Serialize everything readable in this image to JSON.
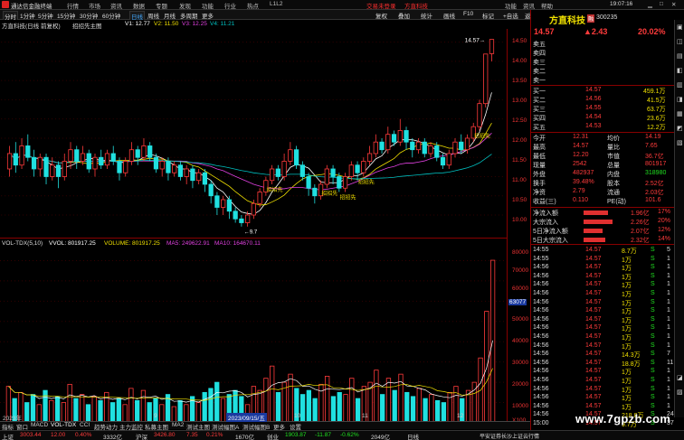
{
  "titlebar": {
    "app_name": "通达信金融终端",
    "menus": [
      "行情",
      "市场",
      "资讯",
      "数据",
      "专题",
      "发现",
      "功能",
      "行业",
      "热点",
      "L1L2"
    ],
    "promo": "交易未登录",
    "stock_tag": "方直科技",
    "right_items": [
      "功能",
      "资讯",
      "帮助"
    ],
    "time": "19:07:16"
  },
  "toolbar": {
    "periods": [
      "分时",
      "1分钟",
      "5分钟",
      "15分钟",
      "30分钟",
      "60分钟",
      "日线",
      "周线",
      "月线",
      "多周期",
      "更多"
    ],
    "right_tools": [
      "复权",
      "叠加",
      "统计",
      "画线",
      "F10",
      "标记",
      "+自选",
      "返回"
    ]
  },
  "chart": {
    "header_name": "方直科技(日线 前复权)",
    "indicator": "招招先主图",
    "ma_v1": "V1: 12.77",
    "ma_v2": "V2: 11.50",
    "ma_v3": "V3: 12.25",
    "ma_v4": "V4: 11.21",
    "peak_label": "14.57",
    "low_label": "9.7",
    "signal_label": "招招先",
    "price_ticks": [
      "14.50",
      "14.00",
      "13.50",
      "13.00",
      "12.50",
      "12.00",
      "11.50",
      "11.00",
      "10.50",
      "10.00"
    ],
    "volume_header": {
      "name": "VOL-TDX(5,10)",
      "vvol": "VVOL: 801917.25",
      "volume": "VOLUME: 801917.25",
      "ma5": "MA5: 249622.91",
      "ma10": "MA10: 164670.11"
    },
    "volume_ticks": [
      "80000",
      "70000",
      "60000",
      "50000",
      "40000",
      "30000",
      "20000",
      "10000"
    ],
    "volume_unit": "X100",
    "volume_marker": "63077",
    "time_labels": [
      "2023年",
      "9",
      "10",
      "11",
      "12",
      "2023/09/15/五"
    ],
    "candles": [
      {
        "o": 11.2,
        "c": 11.6,
        "h": 11.8,
        "l": 11.0
      },
      {
        "o": 11.6,
        "c": 11.3,
        "h": 11.9,
        "l": 11.1
      },
      {
        "o": 11.3,
        "c": 11.8,
        "h": 12.0,
        "l": 11.2
      },
      {
        "o": 11.8,
        "c": 11.5,
        "h": 12.1,
        "l": 11.4
      },
      {
        "o": 11.5,
        "c": 11.2,
        "h": 11.7,
        "l": 11.0
      },
      {
        "o": 11.2,
        "c": 11.5,
        "h": 11.6,
        "l": 11.0
      },
      {
        "o": 11.5,
        "c": 11.0,
        "h": 11.6,
        "l": 10.8
      },
      {
        "o": 11.0,
        "c": 11.3,
        "h": 11.5,
        "l": 10.9
      },
      {
        "o": 11.3,
        "c": 11.0,
        "h": 11.4,
        "l": 10.7
      },
      {
        "o": 11.0,
        "c": 11.4,
        "h": 11.6,
        "l": 10.9
      },
      {
        "o": 11.4,
        "c": 11.7,
        "h": 11.9,
        "l": 11.2
      },
      {
        "o": 11.7,
        "c": 11.4,
        "h": 11.8,
        "l": 11.2
      },
      {
        "o": 11.4,
        "c": 11.6,
        "h": 11.8,
        "l": 11.3
      },
      {
        "o": 11.6,
        "c": 11.2,
        "h": 11.7,
        "l": 11.1
      },
      {
        "o": 11.2,
        "c": 11.5,
        "h": 11.6,
        "l": 11.0
      },
      {
        "o": 11.5,
        "c": 11.3,
        "h": 11.7,
        "l": 11.2
      },
      {
        "o": 11.3,
        "c": 11.6,
        "h": 11.7,
        "l": 11.2
      },
      {
        "o": 11.6,
        "c": 11.4,
        "h": 11.8,
        "l": 11.3
      },
      {
        "o": 11.4,
        "c": 11.1,
        "h": 11.5,
        "l": 10.9
      },
      {
        "o": 11.1,
        "c": 11.4,
        "h": 11.5,
        "l": 11.0
      },
      {
        "o": 11.4,
        "c": 11.7,
        "h": 11.9,
        "l": 11.3
      },
      {
        "o": 11.7,
        "c": 11.5,
        "h": 11.8,
        "l": 11.3
      },
      {
        "o": 11.5,
        "c": 11.8,
        "h": 12.0,
        "l": 11.4
      },
      {
        "o": 11.8,
        "c": 11.5,
        "h": 11.9,
        "l": 11.4
      },
      {
        "o": 11.5,
        "c": 11.2,
        "h": 11.6,
        "l": 11.1
      },
      {
        "o": 11.2,
        "c": 11.4,
        "h": 11.5,
        "l": 11.0
      },
      {
        "o": 11.4,
        "c": 11.1,
        "h": 11.5,
        "l": 10.9
      },
      {
        "o": 11.1,
        "c": 11.3,
        "h": 11.4,
        "l": 11.0
      },
      {
        "o": 11.3,
        "c": 11.0,
        "h": 11.4,
        "l": 10.9
      },
      {
        "o": 11.0,
        "c": 11.2,
        "h": 11.3,
        "l": 10.8
      },
      {
        "o": 11.2,
        "c": 10.9,
        "h": 11.3,
        "l": 10.7
      },
      {
        "o": 10.9,
        "c": 11.1,
        "h": 11.2,
        "l": 10.8
      },
      {
        "o": 11.1,
        "c": 10.8,
        "h": 11.2,
        "l": 10.6
      },
      {
        "o": 10.8,
        "c": 10.5,
        "h": 10.9,
        "l": 10.3
      },
      {
        "o": 10.5,
        "c": 10.2,
        "h": 10.6,
        "l": 10.0
      },
      {
        "o": 10.2,
        "c": 10.4,
        "h": 10.5,
        "l": 10.0
      },
      {
        "o": 10.4,
        "c": 10.1,
        "h": 10.5,
        "l": 9.9
      },
      {
        "o": 10.1,
        "c": 9.9,
        "h": 10.2,
        "l": 9.8
      },
      {
        "o": 9.9,
        "c": 9.8,
        "h": 10.0,
        "l": 9.7
      },
      {
        "o": 9.8,
        "c": 10.0,
        "h": 10.1,
        "l": 9.7
      },
      {
        "o": 10.0,
        "c": 10.3,
        "h": 10.4,
        "l": 9.9
      },
      {
        "o": 10.3,
        "c": 10.6,
        "h": 10.7,
        "l": 10.2
      },
      {
        "o": 10.6,
        "c": 10.9,
        "h": 11.0,
        "l": 10.5
      },
      {
        "o": 10.9,
        "c": 11.2,
        "h": 11.3,
        "l": 10.8
      },
      {
        "o": 11.2,
        "c": 11.0,
        "h": 11.3,
        "l": 10.9
      },
      {
        "o": 11.0,
        "c": 11.4,
        "h": 11.6,
        "l": 10.9
      },
      {
        "o": 11.4,
        "c": 11.7,
        "h": 11.9,
        "l": 11.3
      },
      {
        "o": 11.7,
        "c": 11.3,
        "h": 11.8,
        "l": 11.2
      },
      {
        "o": 11.3,
        "c": 11.0,
        "h": 11.4,
        "l": 10.9
      },
      {
        "o": 11.0,
        "c": 10.7,
        "h": 11.1,
        "l": 10.5
      },
      {
        "o": 10.7,
        "c": 10.5,
        "h": 10.8,
        "l": 10.3
      },
      {
        "o": 10.5,
        "c": 10.8,
        "h": 10.9,
        "l": 10.4
      },
      {
        "o": 10.8,
        "c": 11.2,
        "h": 11.3,
        "l": 10.7
      },
      {
        "o": 11.2,
        "c": 11.0,
        "h": 11.3,
        "l": 10.8
      },
      {
        "o": 11.0,
        "c": 10.7,
        "h": 11.1,
        "l": 10.6
      },
      {
        "o": 10.7,
        "c": 11.0,
        "h": 11.1,
        "l": 10.6
      },
      {
        "o": 11.0,
        "c": 11.3,
        "h": 11.4,
        "l": 10.9
      },
      {
        "o": 11.3,
        "c": 11.1,
        "h": 11.4,
        "l": 10.9
      },
      {
        "o": 11.1,
        "c": 11.4,
        "h": 11.5,
        "l": 11.0
      },
      {
        "o": 11.4,
        "c": 11.6,
        "h": 11.8,
        "l": 11.3
      },
      {
        "o": 11.6,
        "c": 11.9,
        "h": 12.1,
        "l": 11.5
      },
      {
        "o": 11.9,
        "c": 11.7,
        "h": 12.0,
        "l": 11.6
      },
      {
        "o": 11.7,
        "c": 12.1,
        "h": 12.3,
        "l": 11.6
      },
      {
        "o": 12.1,
        "c": 11.9,
        "h": 12.2,
        "l": 11.8
      },
      {
        "o": 11.9,
        "c": 12.2,
        "h": 12.5,
        "l": 11.8
      },
      {
        "o": 12.2,
        "c": 11.9,
        "h": 12.3,
        "l": 11.7
      },
      {
        "o": 11.9,
        "c": 11.7,
        "h": 12.0,
        "l": 11.5
      },
      {
        "o": 11.7,
        "c": 11.9,
        "h": 12.0,
        "l": 11.6
      },
      {
        "o": 11.9,
        "c": 11.6,
        "h": 12.0,
        "l": 11.5
      },
      {
        "o": 11.6,
        "c": 11.8,
        "h": 11.9,
        "l": 11.5
      },
      {
        "o": 11.8,
        "c": 11.5,
        "h": 11.9,
        "l": 11.4
      },
      {
        "o": 11.5,
        "c": 11.3,
        "h": 11.6,
        "l": 11.2
      },
      {
        "o": 11.3,
        "c": 11.6,
        "h": 11.7,
        "l": 11.2
      },
      {
        "o": 11.6,
        "c": 11.9,
        "h": 12.0,
        "l": 11.5
      },
      {
        "o": 11.9,
        "c": 11.7,
        "h": 12.1,
        "l": 11.6
      },
      {
        "o": 11.7,
        "c": 12.0,
        "h": 12.1,
        "l": 11.6
      },
      {
        "o": 12.0,
        "c": 12.3,
        "h": 12.4,
        "l": 11.9
      },
      {
        "o": 12.3,
        "c": 12.9,
        "h": 13.0,
        "l": 12.2
      },
      {
        "o": 12.9,
        "c": 14.19,
        "h": 14.19,
        "l": 12.8
      },
      {
        "o": 14.2,
        "c": 14.57,
        "h": 14.57,
        "l": 14.0
      }
    ],
    "volumes": [
      18000,
      12000,
      15000,
      10000,
      14000,
      9000,
      16000,
      11000,
      13000,
      10000,
      19000,
      12000,
      14000,
      9000,
      13000,
      11000,
      15000,
      10000,
      12000,
      9000,
      17000,
      11000,
      16000,
      10000,
      12000,
      9000,
      14000,
      8000,
      11000,
      9000,
      13000,
      10000,
      15000,
      17000,
      20000,
      12000,
      14000,
      16000,
      13000,
      9000,
      18000,
      16000,
      22000,
      28000,
      15000,
      20000,
      24000,
      17000,
      14000,
      16000,
      12000,
      19000,
      23000,
      13000,
      15000,
      14000,
      22000,
      12000,
      18000,
      20000,
      26000,
      14000,
      22000,
      16000,
      24000,
      15000,
      13000,
      17000,
      12000,
      14000,
      11000,
      10000,
      15000,
      18000,
      12000,
      16000,
      20000,
      32000,
      55000,
      80190
    ]
  },
  "panel": {
    "stock_name": "方直科技",
    "stock_tag": "融",
    "stock_code": "300235",
    "price": "14.57",
    "change": "▲2.43",
    "change_pct": "20.02%",
    "ask_labels": [
      "卖五",
      "卖四",
      "卖三",
      "卖二",
      "卖一"
    ],
    "bids": [
      {
        "label": "买一",
        "price": "14.57",
        "vol": "459.1万"
      },
      {
        "label": "买二",
        "price": "14.56",
        "vol": "41.5万"
      },
      {
        "label": "买三",
        "price": "14.55",
        "vol": "63.7万"
      },
      {
        "label": "买四",
        "price": "14.54",
        "vol": "23.6万"
      },
      {
        "label": "买五",
        "price": "14.53",
        "vol": "12.2万"
      }
    ],
    "stats": [
      {
        "l1": "今开",
        "v1": "12.31",
        "l2": "均价",
        "v2": "14.19"
      },
      {
        "l1": "最高",
        "v1": "14.57",
        "l2": "量比",
        "v2": "7.65"
      },
      {
        "l1": "最低",
        "v1": "12.20",
        "l2": "市值",
        "v2": "36.7亿"
      },
      {
        "l1": "现量",
        "v1": "2542",
        "l2": "总量",
        "v2": "801917"
      },
      {
        "l1": "外盘",
        "v1": "482937",
        "l2": "内盘",
        "v2": "318980"
      },
      {
        "l1": "换手",
        "v1": "39.48%",
        "l2": "股本",
        "v2": "2.52亿"
      },
      {
        "l1": "净资",
        "v1": "2.79",
        "l2": "流通",
        "v2": "2.03亿"
      },
      {
        "l1": "收益(三)",
        "v1": "0.110",
        "l2": "PE(动)",
        "v2": "101.6"
      }
    ],
    "flows": [
      {
        "label": "净流入额",
        "value": "1.96亿",
        "pct": "17%",
        "bar": 0.62
      },
      {
        "label": "大宗流入",
        "value": "2.26亿",
        "pct": "20%",
        "bar": 0.72
      },
      {
        "label": "5日净流入额",
        "value": "2.07亿",
        "pct": "12%",
        "bar": 0.48
      },
      {
        "label": "5日大宗流入",
        "value": "2.32亿",
        "pct": "14%",
        "bar": 0.55
      }
    ],
    "ticks": [
      {
        "t": "14:55",
        "p": "14.57",
        "v": "8.7万",
        "d": "S",
        "n": "5"
      },
      {
        "t": "14:55",
        "p": "14.57",
        "v": "1万",
        "d": "S",
        "n": "1"
      },
      {
        "t": "14:56",
        "p": "14.57",
        "v": "1万",
        "d": "S",
        "n": "1"
      },
      {
        "t": "14:56",
        "p": "14.57",
        "v": "1万",
        "d": "S",
        "n": "1"
      },
      {
        "t": "14:56",
        "p": "14.57",
        "v": "1万",
        "d": "S",
        "n": "1"
      },
      {
        "t": "14:56",
        "p": "14.57",
        "v": "1万",
        "d": "S",
        "n": "1"
      },
      {
        "t": "14:56",
        "p": "14.57",
        "v": "1万",
        "d": "S",
        "n": "1"
      },
      {
        "t": "14:56",
        "p": "14.57",
        "v": "1万",
        "d": "S",
        "n": "1"
      },
      {
        "t": "14:56",
        "p": "14.57",
        "v": "1万",
        "d": "S",
        "n": "1"
      },
      {
        "t": "14:56",
        "p": "14.57",
        "v": "1万",
        "d": "S",
        "n": "1"
      },
      {
        "t": "14:56",
        "p": "14.57",
        "v": "1万",
        "d": "S",
        "n": "1"
      },
      {
        "t": "14:56",
        "p": "14.57",
        "v": "1万",
        "d": "S",
        "n": "1"
      },
      {
        "t": "14:56",
        "p": "14.57",
        "v": "14.3万",
        "d": "S",
        "n": "7"
      },
      {
        "t": "14:56",
        "p": "14.57",
        "v": "18.8万",
        "d": "S",
        "n": "11"
      },
      {
        "t": "14:56",
        "p": "14.57",
        "v": "1万",
        "d": "S",
        "n": "1"
      },
      {
        "t": "14:56",
        "p": "14.57",
        "v": "1万",
        "d": "S",
        "n": "1"
      },
      {
        "t": "14:56",
        "p": "14.57",
        "v": "1万",
        "d": "S",
        "n": "1"
      },
      {
        "t": "14:56",
        "p": "14.57",
        "v": "1万",
        "d": "S",
        "n": "1"
      },
      {
        "t": "14:56",
        "p": "14.57",
        "v": "1万",
        "d": "S",
        "n": "1"
      },
      {
        "t": "14:56",
        "p": "14.57",
        "v": "218.8万",
        "d": "S",
        "n": "24"
      },
      {
        "t": "15:00",
        "p": "14.57",
        "v": "9.7万",
        "d": "S",
        "n": "37"
      }
    ]
  },
  "subtabs": [
    "指标",
    "窗口",
    "MACD",
    "VOL-TDX",
    "CCI",
    "趋势动力",
    "主力监控",
    "私募主图",
    "MA2",
    "测试主图",
    "测试幅图A",
    "测试幅图B",
    "更多",
    "设置"
  ],
  "bottom_tabs": [
    "日线",
    "关联股份",
    "资金分布",
    "综合资讯",
    "行业资讯",
    "互动问答",
    "普及新功能说明"
  ],
  "statusbar": {
    "items": [
      {
        "name": "上证",
        "val": "3003.44",
        "chg": "12.00",
        "pct": "0.40%",
        "amt": "3332亿"
      },
      {
        "name": "沪深",
        "val": "3426.80",
        "chg": "7.35",
        "pct": "0.21%",
        "amt": "1670亿"
      },
      {
        "name": "创业",
        "val": "1903.87",
        "chg": "-11.87",
        "pct": "-0.62%",
        "amt": "2049亿"
      }
    ],
    "right_text": "平安证券长沙上证云行情"
  },
  "watermark": "www.7gpzb.com",
  "colors": {
    "up": "#ff3b3b",
    "down": "#20e0e0",
    "ma1": "#ffffff",
    "ma2": "#f0e000",
    "ma3": "#e040e0",
    "ma4": "#00c0c0"
  }
}
